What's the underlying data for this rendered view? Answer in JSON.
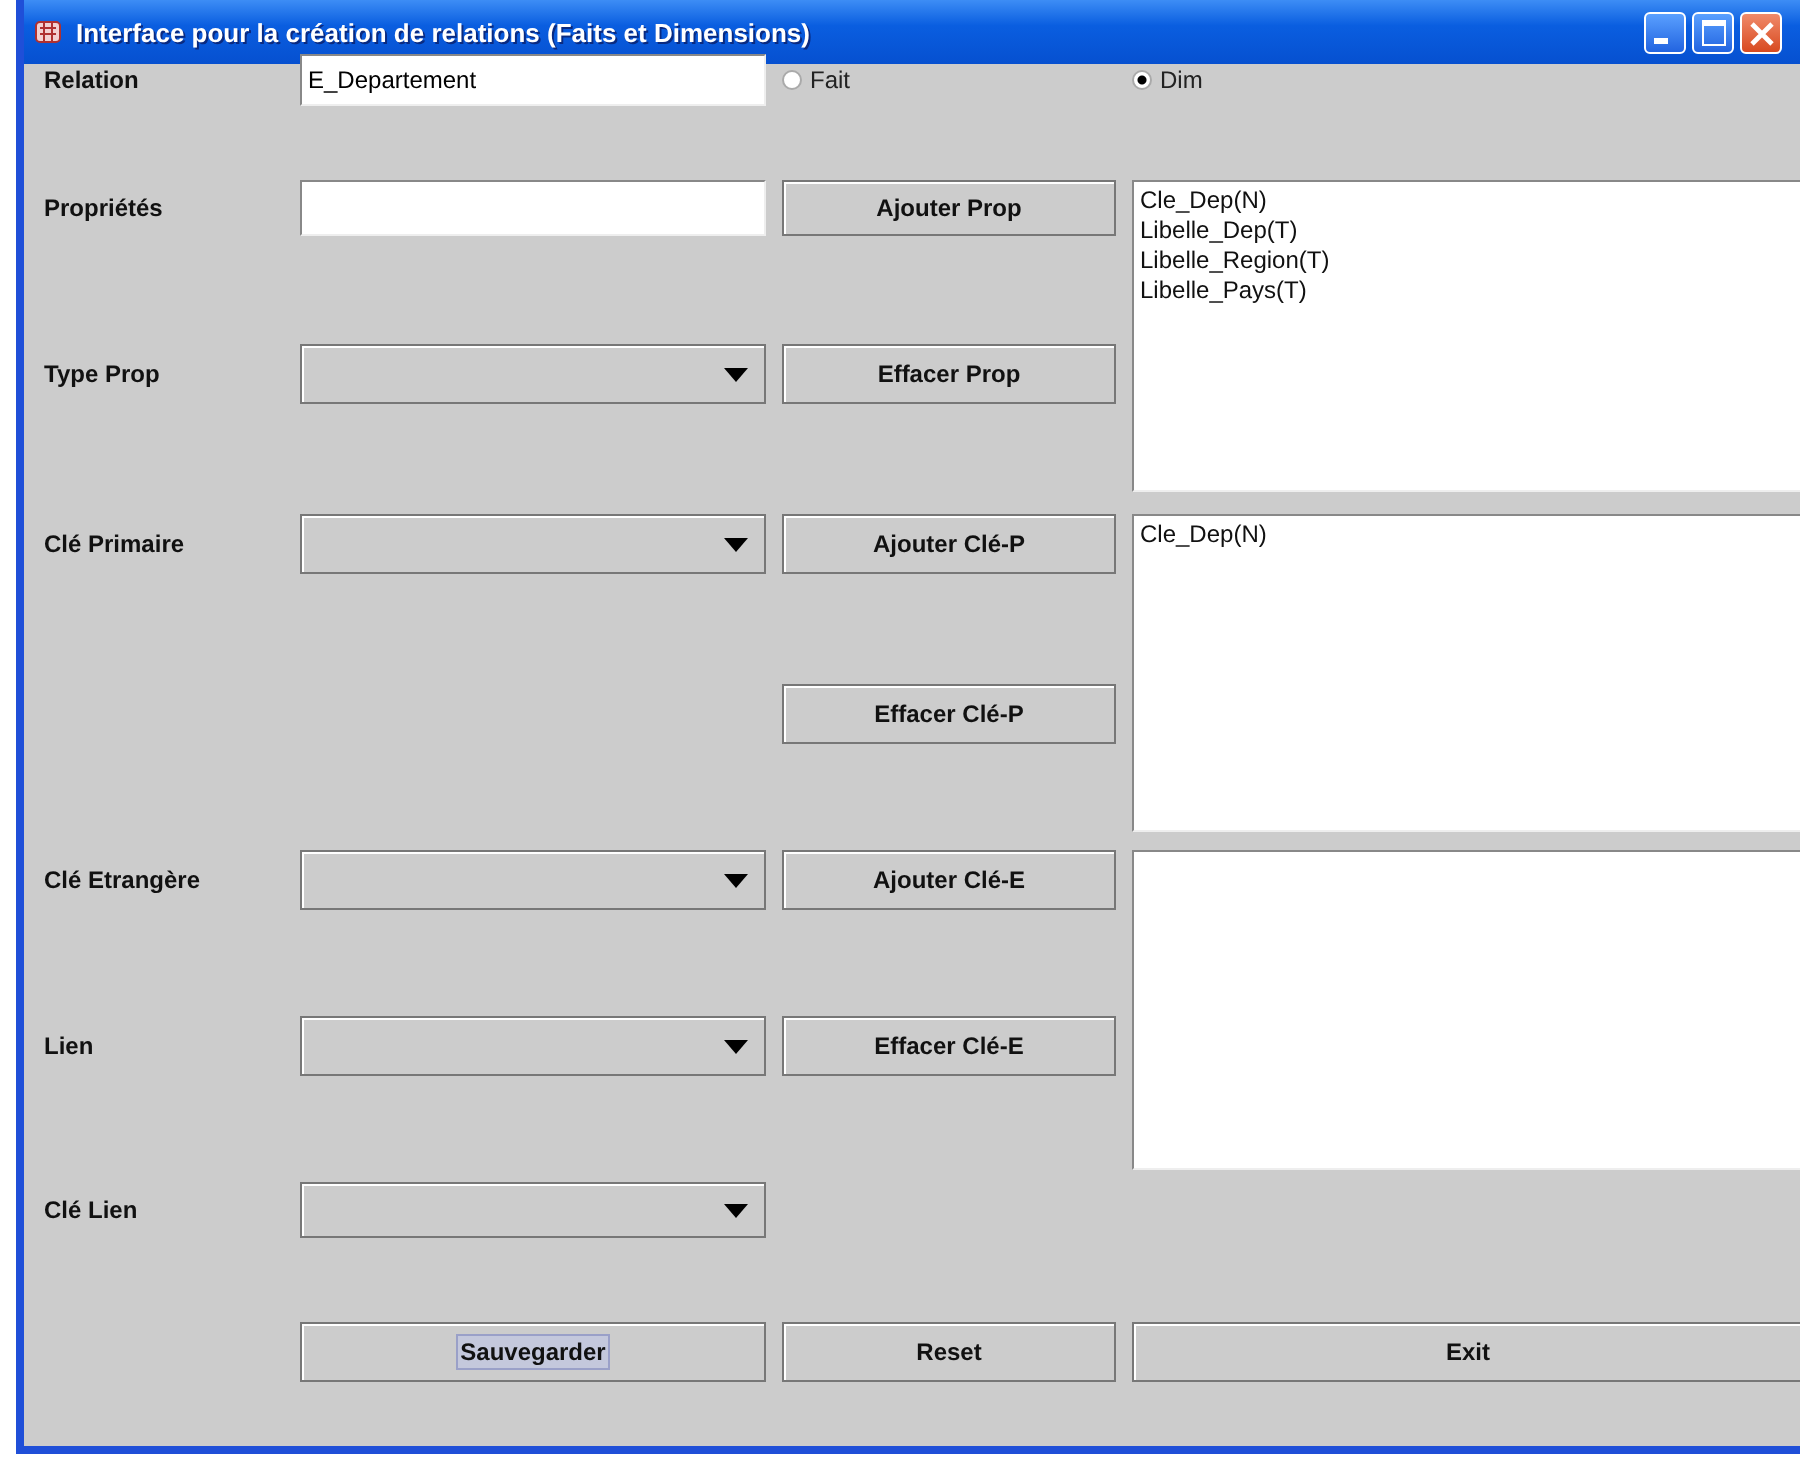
{
  "window": {
    "title": "Interface pour la création de relations (Faits et Dimensions)"
  },
  "relation": {
    "label": "Relation",
    "value": "E_Departement"
  },
  "type_options": [
    {
      "label": "Fait",
      "selected": false
    },
    {
      "label": "Dim",
      "selected": true
    }
  ],
  "rows": [
    {
      "label": "Propriétés",
      "kind": "text",
      "button": "Ajouter Prop"
    },
    {
      "label": "Type Prop",
      "kind": "combo",
      "button": "Effacer Prop"
    },
    {
      "label": "Clé Primaire",
      "kind": "combo",
      "button": "Ajouter Clé-P"
    },
    {
      "button": "Effacer Clé-P"
    },
    {
      "label": "Clé Etrangère",
      "kind": "combo",
      "button": "Ajouter Clé-E"
    },
    {
      "label": "Lien",
      "kind": "combo",
      "button": "Effacer Clé-E"
    },
    {
      "label": "Clé Lien",
      "kind": "combo"
    }
  ],
  "lists": [
    {
      "items": [
        "Cle_Dep(N)",
        "Libelle_Dep(T)",
        "Libelle_Region(T)",
        "Libelle_Pays(T)"
      ]
    },
    {
      "items": [
        "Cle_Dep(N)"
      ]
    }
  ],
  "bottom_buttons": [
    {
      "label": "Sauvegarder",
      "focused": true
    },
    {
      "label": "Reset",
      "focused": false
    },
    {
      "label": "Exit",
      "focused": false
    }
  ]
}
